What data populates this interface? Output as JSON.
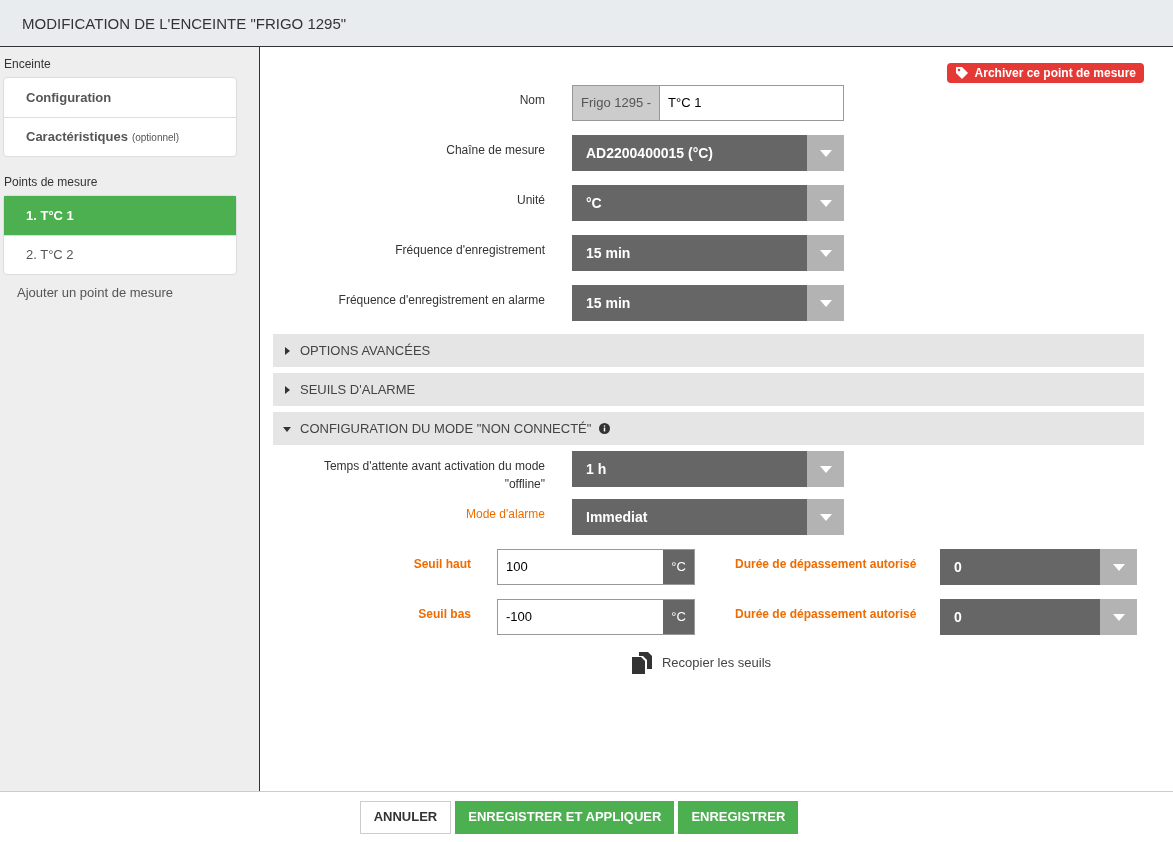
{
  "dialog": {
    "title": "MODIFICATION DE L'ENCEINTE \"FRIGO 1295\""
  },
  "sidebar": {
    "sections": [
      {
        "heading": "Enceinte",
        "items": [
          {
            "label": "Configuration",
            "selected": false
          },
          {
            "label": "Caractéristiques",
            "note": "(optionnel)",
            "selected": false
          }
        ]
      },
      {
        "heading": "Points de mesure",
        "items": [
          {
            "label": "1. T°C 1",
            "selected": true
          },
          {
            "label": "2. T°C 2",
            "selected": false
          }
        ]
      }
    ],
    "add_link": "Ajouter un point de mesure"
  },
  "archive_button": "Archiver ce point de mesure",
  "name_field": {
    "label": "Nom",
    "prefix": "Frigo 1295 -",
    "value": "T°C 1"
  },
  "fields": [
    {
      "label": "Chaîne de mesure",
      "value": "AD2200400015 (°C)"
    },
    {
      "label": "Unité",
      "value": "°C"
    },
    {
      "label": "Fréquence d'enregistrement",
      "value": "15 min"
    },
    {
      "label": "Fréquence d'enregistrement en alarme",
      "value": "15 min"
    }
  ],
  "sections": [
    {
      "title": "OPTIONS AVANCÉES",
      "expanded": false,
      "info": false
    },
    {
      "title": "SEUILS D'ALARME",
      "expanded": false,
      "info": false
    },
    {
      "title": "CONFIGURATION DU MODE \"NON CONNECTÉ\"",
      "expanded": true,
      "info": true
    }
  ],
  "offline_fields": [
    {
      "label": "Temps d'attente avant activation du mode \"offline\"",
      "value": "1 h",
      "required": false
    },
    {
      "label": "Mode d'alarme",
      "value": "Immediat",
      "required": true
    }
  ],
  "thresholds": [
    {
      "label": "Seuil haut",
      "value": "100",
      "unit": "°C",
      "duration_label": "Durée de dépassement autorisé",
      "duration": "0"
    },
    {
      "label": "Seuil bas",
      "value": "-100",
      "unit": "°C",
      "duration_label": "Durée de dépassement autorisé",
      "duration": "0"
    }
  ],
  "copy_link": "Recopier les seuils",
  "footer_buttons": [
    {
      "label": "ANNULER",
      "kind": "secondary"
    },
    {
      "label": "ENREGISTRER ET APPLIQUER",
      "kind": "primary"
    },
    {
      "label": "ENREGISTRER",
      "kind": "primary"
    }
  ]
}
